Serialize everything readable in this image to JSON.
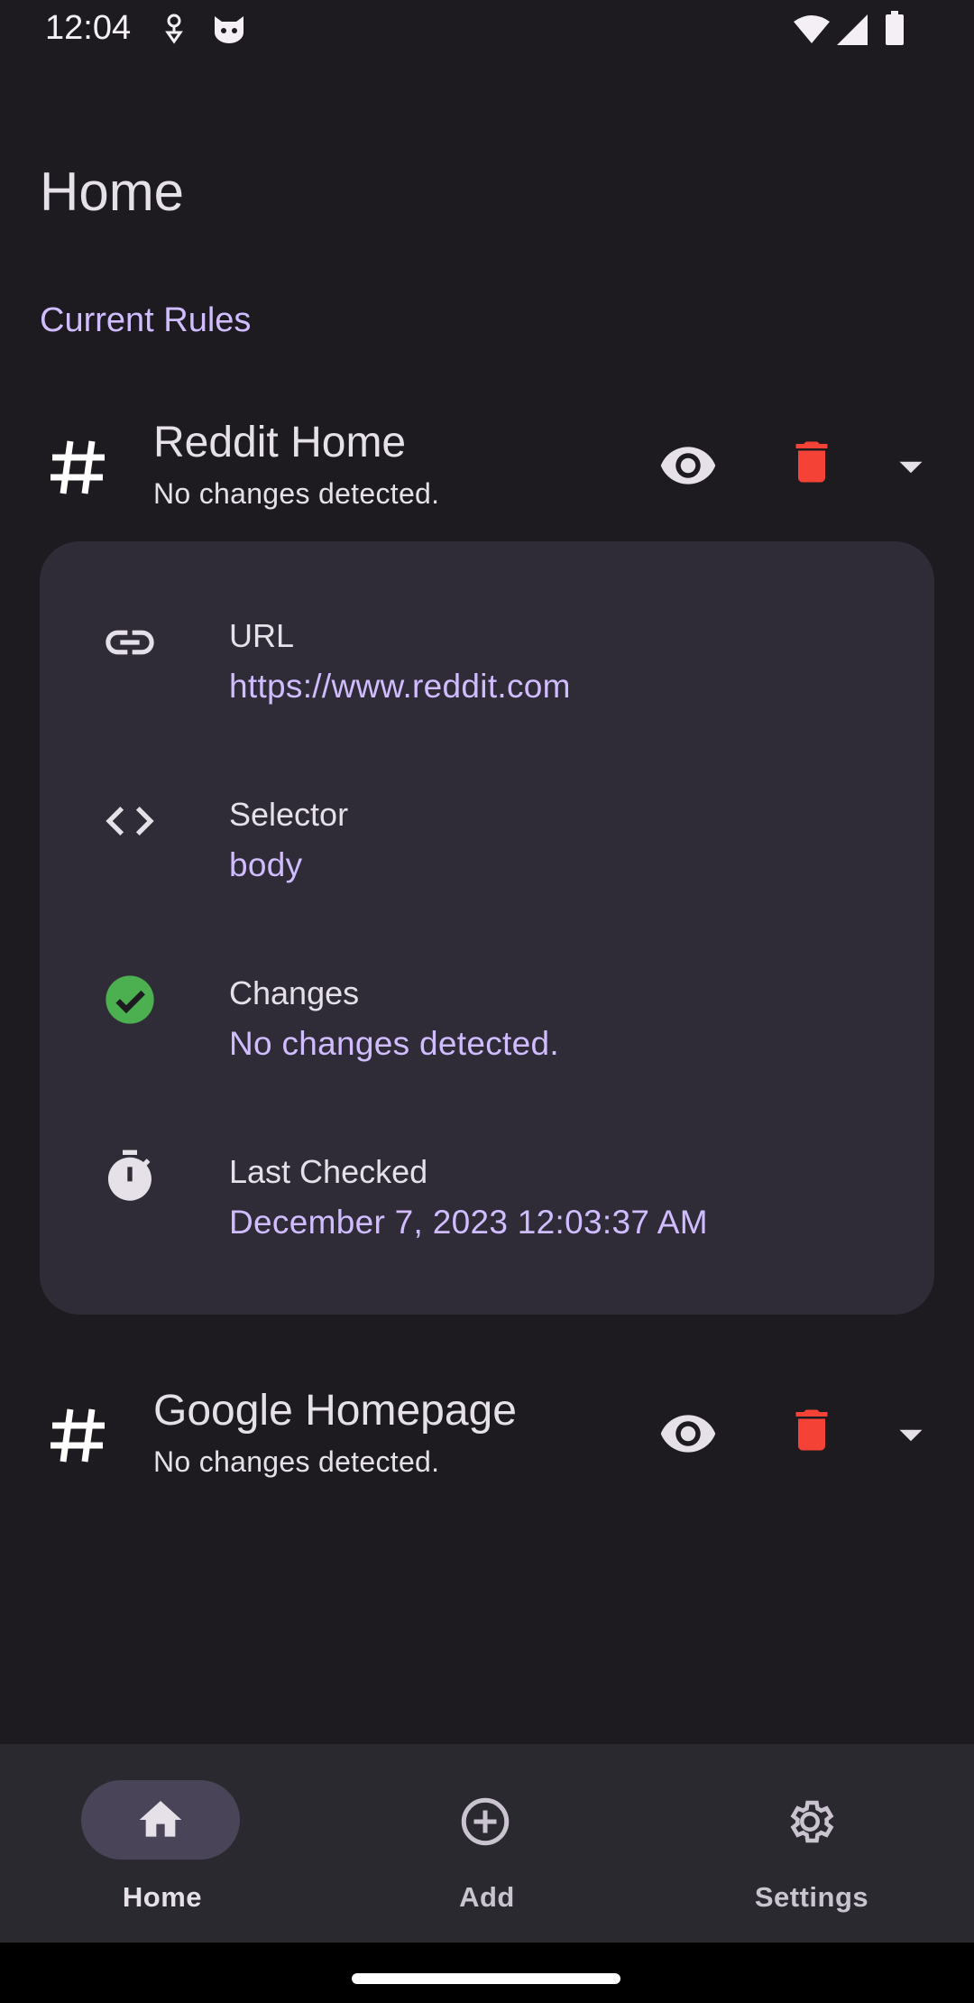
{
  "status_bar": {
    "time": "12:04",
    "icons": [
      "key-icon",
      "cat-icon",
      "wifi-icon",
      "signal-icon",
      "battery-icon"
    ]
  },
  "page": {
    "title": "Home",
    "section_label": "Current Rules"
  },
  "rules": [
    {
      "title": "Reddit Home",
      "subtitle": "No changes detected.",
      "expanded": true
    },
    {
      "title": "Google Homepage",
      "subtitle": "No changes detected.",
      "expanded": false
    }
  ],
  "details": {
    "url": {
      "label": "URL",
      "value": "https://www.reddit.com",
      "icon": "link-icon"
    },
    "selector": {
      "label": "Selector",
      "value": "body",
      "icon": "code-icon"
    },
    "changes": {
      "label": "Changes",
      "value": "No changes detected.",
      "icon": "check-circle-icon"
    },
    "last_checked": {
      "label": "Last Checked",
      "value": "December 7, 2023 12:03:37 AM",
      "icon": "timer-icon"
    }
  },
  "nav": {
    "items": [
      {
        "label": "Home",
        "icon": "home-icon",
        "active": true
      },
      {
        "label": "Add",
        "icon": "add-circle-icon",
        "active": false
      },
      {
        "label": "Settings",
        "icon": "gear-icon",
        "active": false
      }
    ]
  },
  "colors": {
    "background": "#1d1b20",
    "accent": "#d0bcff",
    "card": "#2f2c38",
    "delete": "#f44336",
    "success": "#4caf50",
    "nav_background": "#2b2930"
  }
}
